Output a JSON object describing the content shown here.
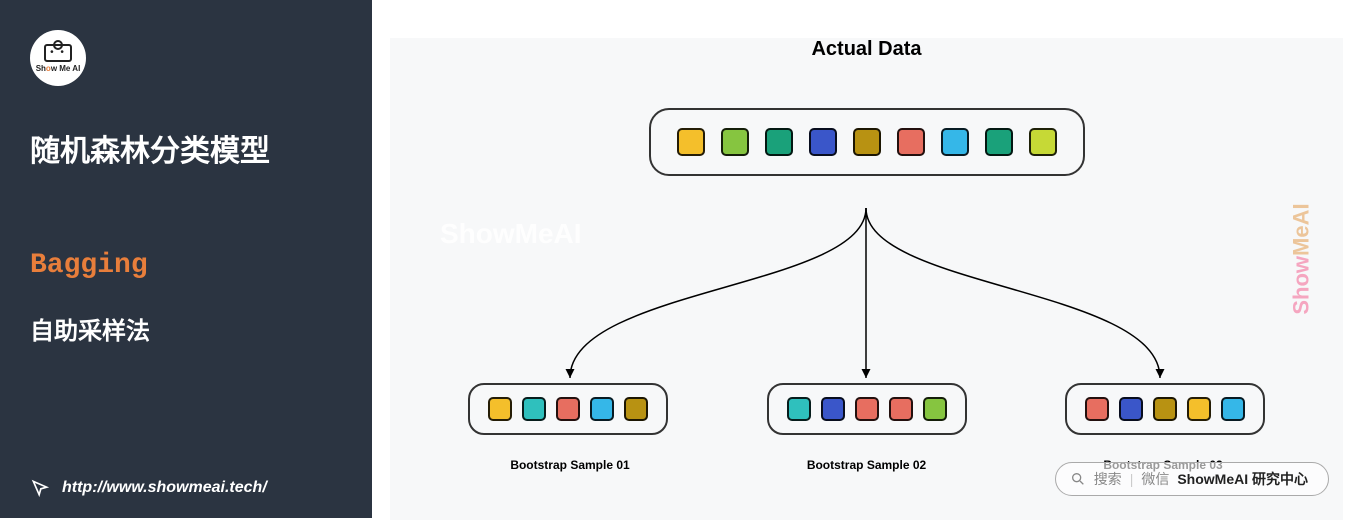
{
  "sidebar": {
    "logo_text_parts": [
      "Sh",
      "o",
      "w Me AI"
    ],
    "title": "随机森林分类模型",
    "subtitle1": "Bagging",
    "subtitle2": "自助采样法",
    "url": "http://www.showmeai.tech/"
  },
  "diagram": {
    "title": "Actual Data",
    "watermark": "ShowMeAI",
    "side_watermark": "ShowMeAI",
    "root_colors": [
      "#f4bf2b",
      "#86c540",
      "#1aa17a",
      "#3a56c9",
      "#b89212",
      "#e76e60",
      "#35b7e8",
      "#1aa17a",
      "#c6d936"
    ],
    "samples": [
      {
        "label": "Bootstrap Sample 01",
        "colors": [
          "#f4bf2b",
          "#2fc0bd",
          "#e76e60",
          "#35b7e8",
          "#b89212"
        ]
      },
      {
        "label": "Bootstrap Sample 02",
        "colors": [
          "#2fc0bd",
          "#3a56c9",
          "#e76e60",
          "#e76e60",
          "#86c540"
        ]
      },
      {
        "label": "Bootstrap Sample 03",
        "colors": [
          "#e76e60",
          "#3a56c9",
          "#b89212",
          "#f4bf2b",
          "#35b7e8"
        ]
      }
    ]
  },
  "search": {
    "hint1": "搜索",
    "hint2": "微信",
    "strong": "ShowMeAI 研究中心"
  }
}
